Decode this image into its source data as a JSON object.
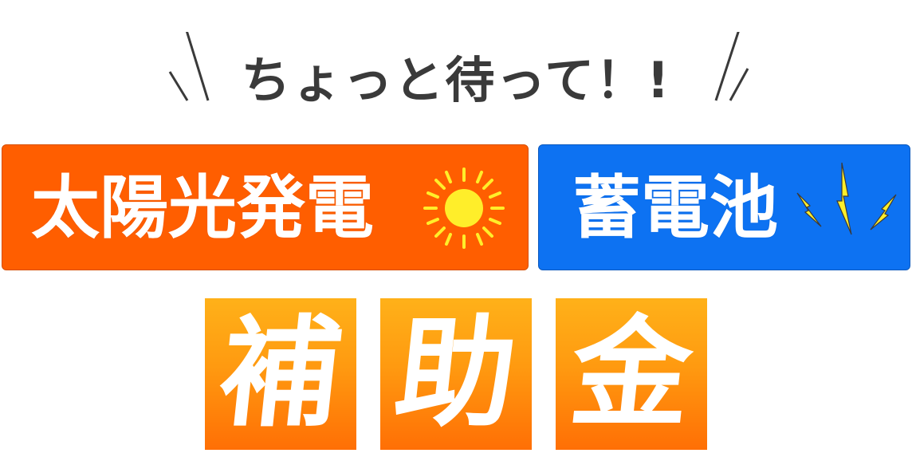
{
  "headline": {
    "text": "ちょっと待って！!"
  },
  "banners": {
    "solar": {
      "label": "太陽光発電",
      "icon": "sun-icon",
      "color": "#ff5e00"
    },
    "battery": {
      "label": "蓄電池",
      "icon": "lightning-bolt-icon",
      "color": "#0d72f2"
    }
  },
  "subsidy": {
    "chars": [
      "補",
      "助",
      "金"
    ],
    "gradient_top": "#ffb119",
    "gradient_bottom": "#ff6f05"
  },
  "colors": {
    "headline_text": "#3a3a3a",
    "sun": "#ffee2a",
    "bolt": "#ffee2a"
  }
}
